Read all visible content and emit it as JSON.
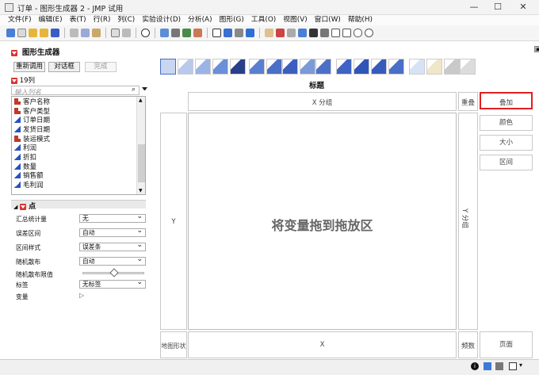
{
  "window": {
    "title": "订单 - 图形生成器 2 - JMP 试用",
    "controls": [
      "—",
      "☐",
      "✕"
    ]
  },
  "menu": [
    "文件(F)",
    "编辑(E)",
    "表(T)",
    "行(R)",
    "列(C)",
    "实验设计(D)",
    "分析(A)",
    "图形(G)",
    "工具(O)",
    "视图(V)",
    "窗口(W)",
    "帮助(H)"
  ],
  "panel": {
    "title": "图形生成器",
    "undo": "重新调用",
    "dialog": "对话框",
    "done": "完成",
    "col_count": "19列",
    "search_placeholder": "输入列名",
    "columns": [
      {
        "name": "客户名称",
        "type": "nominal"
      },
      {
        "name": "客户类型",
        "type": "nominal"
      },
      {
        "name": "订单日期",
        "type": "continuous"
      },
      {
        "name": "发货日期",
        "type": "continuous"
      },
      {
        "name": "装运模式",
        "type": "nominal"
      },
      {
        "name": "利润",
        "type": "continuous"
      },
      {
        "name": "折扣",
        "type": "continuous"
      },
      {
        "name": "数量",
        "type": "continuous"
      },
      {
        "name": "销售额",
        "type": "continuous"
      },
      {
        "name": "毛利润",
        "type": "continuous"
      }
    ]
  },
  "points": {
    "title": "点",
    "rows": [
      {
        "label": "汇总统计量",
        "value": "无"
      },
      {
        "label": "误差区间",
        "value": "自动"
      },
      {
        "label": "区间样式",
        "value": "误差条"
      },
      {
        "label": "随机散布",
        "value": "自动"
      },
      {
        "label": "随机散布限值",
        "value": ""
      },
      {
        "label": "标签",
        "value": "无标签"
      },
      {
        "label": "变量",
        "value": ""
      }
    ],
    "jitter_slider": 0.5
  },
  "graph": {
    "title": "标题",
    "x_group": "X 分组",
    "overlay_label_short": "重叠",
    "y": "Y",
    "y_group": "Y 分组",
    "drop_zone": "将变量拖到拖放区",
    "map_shape": "地图形状",
    "x": "X",
    "freq": "频数",
    "right_buttons": [
      "叠加",
      "颜色",
      "大小",
      "区间"
    ],
    "page": "页面"
  }
}
